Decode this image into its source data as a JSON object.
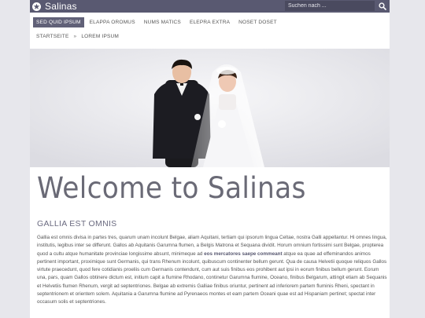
{
  "header": {
    "site_title": "Salinas",
    "search_placeholder": "Suchen nach ..."
  },
  "nav": {
    "items": [
      {
        "label": "SED QUID IPSUM",
        "active": true
      },
      {
        "label": "ELAPPA OROMUS",
        "active": false
      },
      {
        "label": "NUMS MATICS",
        "active": false
      },
      {
        "label": "ELEPRA EXTRA",
        "active": false
      },
      {
        "label": "NOSET DOSET",
        "active": false
      }
    ]
  },
  "breadcrumb": {
    "home": "STARTSEITE",
    "separator": "»",
    "current": "LOREM IPSUM"
  },
  "main": {
    "title": "Welcome to Salinas",
    "section_title": "GALLIA EST OMNIS",
    "paragraph_before": "Gallia est omnis divisa in partes tres, quarum unam incolunt Belgae, aliam Aquitani, tertiam qui ipsorum lingua Celtae, nostra Galli appellantur. Hi omnes lingua, institutis, legibus inter se differunt. Gallos ab Aquitanis Garumna flumen, a Belgis Matrona et Sequana dividit. Horum omnium fortissimi sunt Belgae, propterea quod a cultu atque humanitate provinciae longissime absunt, minimeque ad ",
    "paragraph_bold": "eos mercatores saepe commeant",
    "paragraph_after": " atque ea quae ad effeminandos animos pertinent important, proximique sunt Germanis, qui trans Rhenum incolunt, quibuscum continenter bellum gerunt. Qua de causa Helvetii quoque reliquos Gallos virtute praecedunt, quod fere cotidianis proeliis cum Germanis contendunt, cum aut suis finibus eos prohibent aut ipsi in eorum finibus bellum gerunt. Eorum una, pars, quam Gallos obtinere dictum est, initium capit a flumine Rhodano, continetur Garumna flumine, Oceano, finibus Belgarum, attingit etiam ab Sequanis et Helvetiis flumen Rhenum, vergit ad septentriones. Belgae ab extremis Galliae finibus oriuntur, pertinent ad inferiorem partem fluminis Rheni, spectant in septentrionem et orientem solem. Aquitania a Garumna flumine ad Pyrenaeos montes et eam partem Oceani quae est ad Hispaniam pertinet; spectat inter occasum solis et septentriones."
  },
  "colors": {
    "topbar": "#595971",
    "accent": "#616178",
    "background": "#e7e7ec"
  },
  "icons": {
    "logo": "star-circle-icon",
    "search": "search-icon"
  }
}
